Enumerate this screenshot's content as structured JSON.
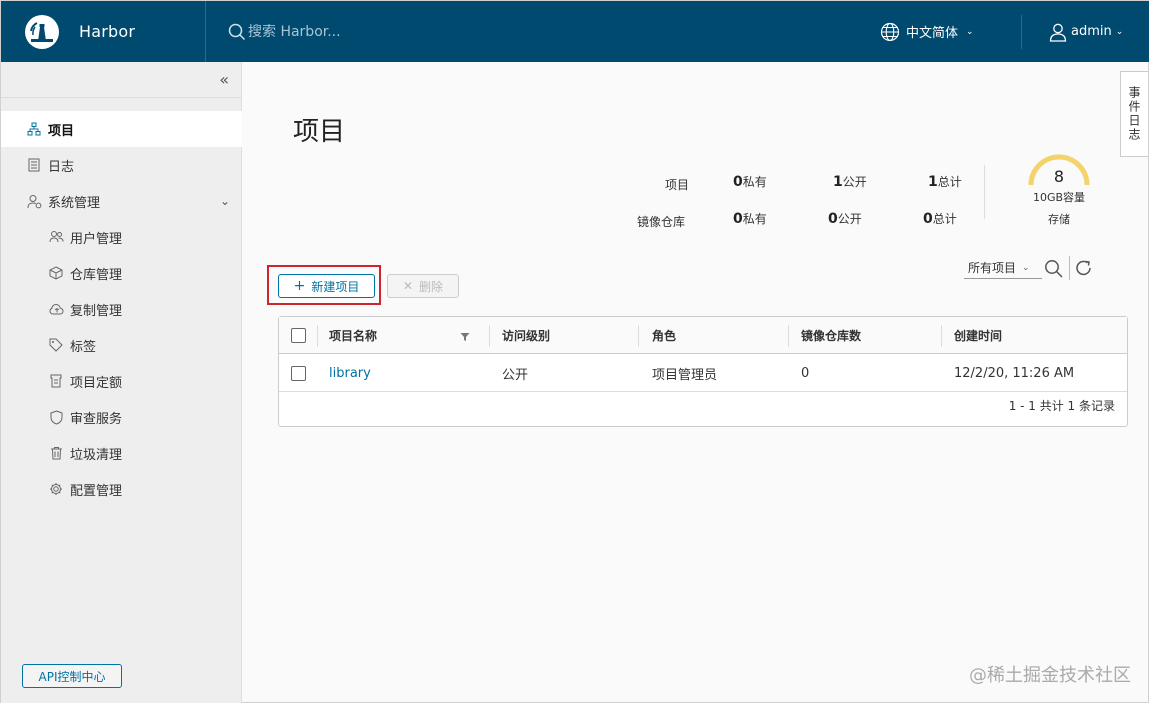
{
  "header": {
    "brand": "Harbor",
    "search_placeholder": "搜索 Harbor...",
    "language": "中文简体",
    "user": "admin",
    "bg_color": "#004a70"
  },
  "sidebar": {
    "items": [
      {
        "label": "项目",
        "icon": "project-tree-icon",
        "active": true
      },
      {
        "label": "日志",
        "icon": "log-icon"
      },
      {
        "label": "系统管理",
        "icon": "admin-icon",
        "expandable": true
      }
    ],
    "sub_items": [
      {
        "label": "用户管理",
        "icon": "users-icon"
      },
      {
        "label": "仓库管理",
        "icon": "box-icon"
      },
      {
        "label": "复制管理",
        "icon": "cloud-sync-icon"
      },
      {
        "label": "标签",
        "icon": "tag-icon"
      },
      {
        "label": "项目定额",
        "icon": "quota-icon"
      },
      {
        "label": "审查服务",
        "icon": "shield-icon"
      },
      {
        "label": "垃圾清理",
        "icon": "trash-icon"
      },
      {
        "label": "配置管理",
        "icon": "gear-icon"
      }
    ],
    "api_button": "API控制中心"
  },
  "event_log_tab": "事件日志",
  "main": {
    "title": "项目",
    "stats": {
      "project_label": "项目",
      "repo_label": "镜像仓库",
      "project": {
        "private": "0",
        "public": "1",
        "total": "1"
      },
      "repo": {
        "private": "0",
        "public": "0",
        "total": "0"
      },
      "private_suffix": "私有",
      "public_suffix": "公开",
      "total_suffix": "总计"
    },
    "storage": {
      "count": "8",
      "capacity": "10GB容量",
      "label": "存储",
      "gauge_color": "#f5d36b"
    },
    "toolbar": {
      "new_project": "新建项目",
      "delete": "删除",
      "filter_selected": "所有项目"
    },
    "table": {
      "columns": [
        "项目名称",
        "访问级别",
        "角色",
        "镜像仓库数",
        "创建时间"
      ],
      "rows": [
        {
          "name": "library",
          "access": "公开",
          "role": "项目管理员",
          "repo_count": "0",
          "created": "12/2/20, 11:26 AM"
        }
      ],
      "footer": "1 - 1 共计 1 条记录"
    }
  },
  "watermark": "@稀土掘金技术社区"
}
